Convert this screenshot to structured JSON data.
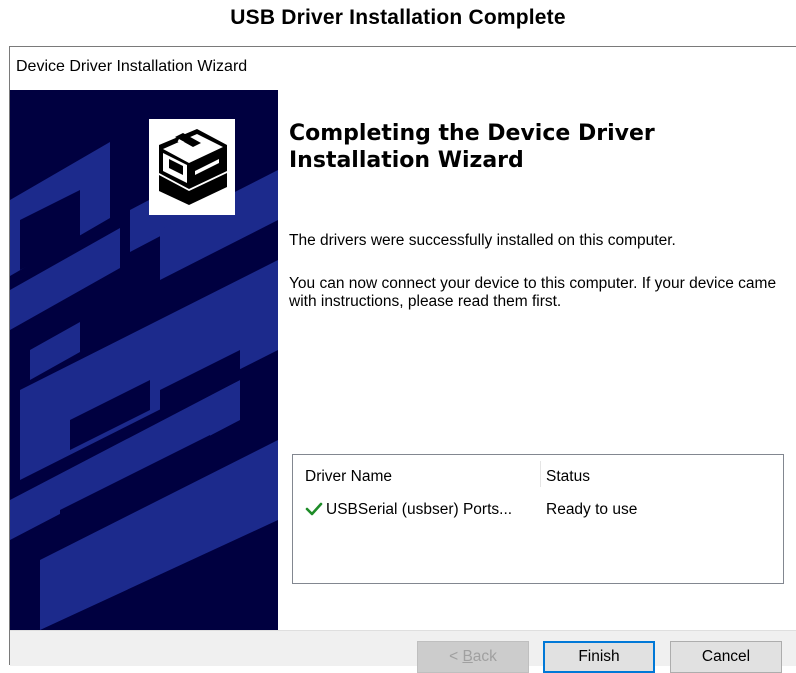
{
  "caption": "USB Driver Installation Complete",
  "window": {
    "title": "Device Driver Installation Wizard"
  },
  "content": {
    "heading": "Completing the Device Driver Installation Wizard",
    "paragraph1": "The drivers were successfully installed on this computer.",
    "paragraph2": "You can now connect your device to this computer. If your device came with instructions, please read them first."
  },
  "driver_list": {
    "columns": [
      "Driver Name",
      "Status"
    ],
    "rows": [
      {
        "icon": "checkmark-icon",
        "name": "USBSerial (usbser) Ports...",
        "status": "Ready to use"
      }
    ]
  },
  "buttons": {
    "back_prefix": "< ",
    "back_mnemonic": "B",
    "back_rest": "ack",
    "finish": "Finish",
    "cancel": "Cancel"
  },
  "colors": {
    "sidebar_bg": "#000040",
    "sidebar_pattern": "#1c2a8c",
    "check_green": "#1e8c28",
    "default_button_border": "#0078d7"
  }
}
